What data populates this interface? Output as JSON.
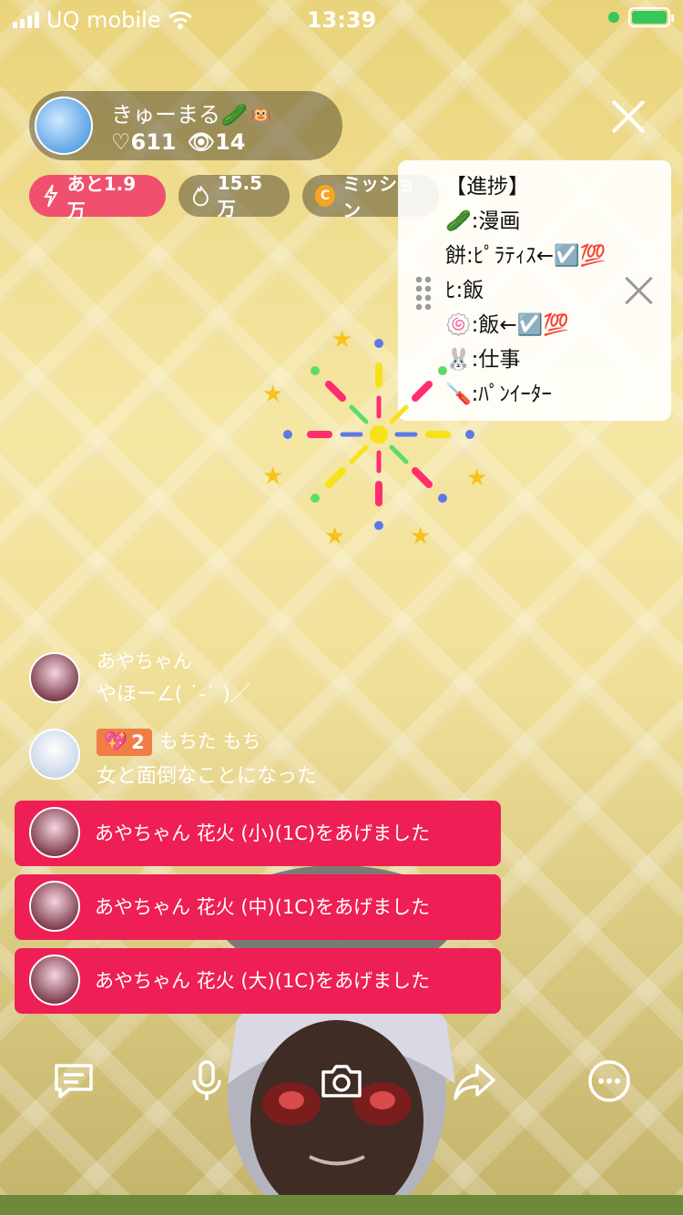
{
  "status_bar": {
    "carrier": "UQ mobile",
    "time": "13:39"
  },
  "host": {
    "name": "きゅーまる🥒🙉",
    "likes": "♡611",
    "viewers": "👁14"
  },
  "pills": {
    "boost": "あと1.9万",
    "points": "15.5万",
    "mission": "ミッション"
  },
  "progress_panel": {
    "lines": [
      "【進捗】",
      "🥒:漫画",
      "餅:ﾋﾟﾗﾃｨｽ←☑️💯",
      "ﾋ:飯",
      "🍥:飯←☑️💯",
      "🐰:仕事",
      "🪛:ﾊﾟﾝｲｰﾀｰ"
    ]
  },
  "chat": [
    {
      "user": "あやちゃん",
      "message": "やほー∠( ˙-˙ )／"
    },
    {
      "badge_level": "2",
      "user": "もちた もち",
      "message": "女と面倒なことになった"
    }
  ],
  "gifts": [
    {
      "text": "あやちゃん 花火 (小)(1C)をあげました"
    },
    {
      "text": "あやちゃん 花火 (中)(1C)をあげました"
    },
    {
      "text": "あやちゃん 花火 (大)(1C)をあげました"
    }
  ],
  "toolbar": {
    "icons": [
      "comment-icon",
      "mic-icon",
      "camera-icon",
      "share-icon",
      "more-icon"
    ]
  },
  "colors": {
    "gift_bg": "#ee1f55",
    "boost_pill": "#f0506e",
    "badge": "#f07d45"
  }
}
